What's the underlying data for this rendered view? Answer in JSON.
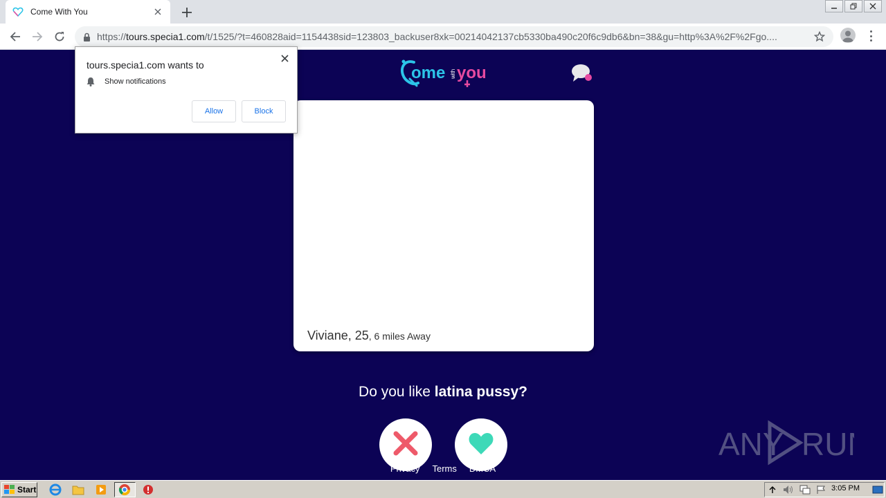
{
  "browser": {
    "tab_title": "Come With You",
    "url_scheme": "https://",
    "url_host": "tours.specia1.com",
    "url_path": "/t/1525/?t=460828aid=1154438sid=123803_backuser8xk=00214042137cb5330ba490c20f6c9db6&bn=38&gu=http%3A%2F%2Fgo...."
  },
  "notification": {
    "title": "tours.specia1.com wants to",
    "item_label": "Show notifications",
    "allow_label": "Allow",
    "block_label": "Block"
  },
  "page": {
    "logo_text_1": "ome",
    "logo_text_small": "with",
    "logo_text_2": "you",
    "profile_name": "Viviane, 25",
    "profile_distance": ", 6 miles Away",
    "question_prefix": "Do you like ",
    "question_bold": "latina pussy?",
    "footer_links": [
      "Privacy",
      "Terms",
      "DMCA"
    ]
  },
  "taskbar": {
    "start_label": "Start",
    "clock": "3:05 PM"
  },
  "watermark": {
    "left_text": "ANY",
    "right_text": "RUN"
  },
  "colors": {
    "page_bg": "#0c0355",
    "logo_cyan": "#2cc4e8",
    "logo_pink": "#e64aa0",
    "dislike_red": "#ee5a6a",
    "like_teal": "#3dd9b8"
  },
  "icons": [
    "heart-favicon-icon",
    "back-arrow-icon",
    "forward-arrow-icon",
    "reload-icon",
    "lock-icon",
    "bookmark-star-icon",
    "profile-avatar-icon",
    "menu-dots-icon",
    "chat-bubbles-icon",
    "dislike-x-icon",
    "like-heart-icon",
    "bell-icon",
    "close-icon"
  ]
}
